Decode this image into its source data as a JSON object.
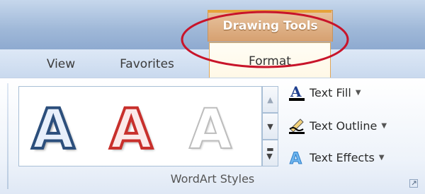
{
  "tabs": {
    "view": "View",
    "favorites": "Favorites",
    "format": "Format"
  },
  "contextual_tab": {
    "label": "Drawing Tools",
    "accent_color": "#e6a33b",
    "highlight_ellipse_color": "#c8142a"
  },
  "wordart_gallery": {
    "items": [
      {
        "glyph": "A",
        "style": "blue-outline"
      },
      {
        "glyph": "A",
        "style": "red-outline"
      },
      {
        "glyph": "A",
        "style": "gray-outline"
      }
    ],
    "scroll_up_icon": "triangle-up",
    "scroll_down_icon": "triangle-down",
    "more_icon": "more-dropdown"
  },
  "commands": {
    "text_fill": "Text Fill",
    "text_outline": "Text Outline",
    "text_effects": "Text Effects"
  },
  "group": {
    "label": "WordArt Styles"
  }
}
